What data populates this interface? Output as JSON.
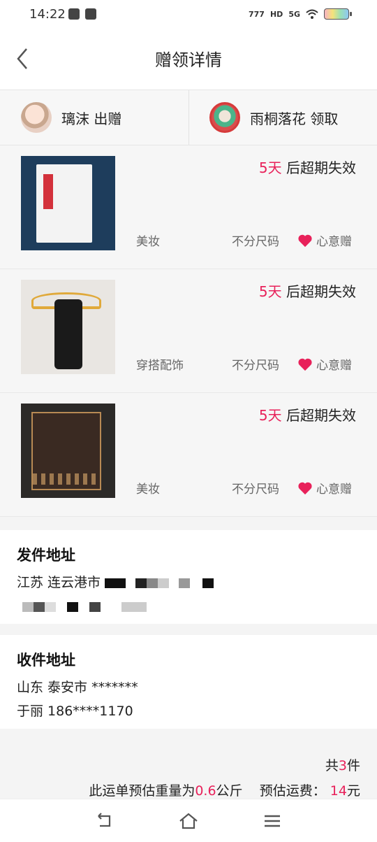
{
  "status_bar": {
    "time": "14:22",
    "network": "5G",
    "hd": "HD",
    "speed": "777"
  },
  "header": {
    "title": "赠领详情"
  },
  "parties": {
    "giver": "璃沫 出赠",
    "receiver": "雨桐落花 领取"
  },
  "items": [
    {
      "expire_days": "5天",
      "expire_text": " 后超期失效",
      "category": "美妆",
      "size": "不分尺码",
      "gift_label": "心意赠"
    },
    {
      "expire_days": "5天",
      "expire_text": " 后超期失效",
      "category": "穿搭配饰",
      "size": "不分尺码",
      "gift_label": "心意赠"
    },
    {
      "expire_days": "5天",
      "expire_text": " 后超期失效",
      "category": "美妆",
      "size": "不分尺码",
      "gift_label": "心意赠"
    }
  ],
  "send_address": {
    "title": "发件地址",
    "line1": "江苏 连云港市"
  },
  "receive_address": {
    "title": "收件地址",
    "line1": "山东 泰安市 *******",
    "line2": "于丽 186****1170"
  },
  "summary": {
    "count_prefix": "共",
    "count": "3",
    "count_suffix": "件",
    "weight_prefix": "此运单预估重量为",
    "weight": "0.6",
    "weight_unit": "公斤",
    "fee_label": "预估运费：",
    "fee": "14",
    "fee_unit": "元"
  },
  "colors": {
    "accent": "#e8215a"
  }
}
